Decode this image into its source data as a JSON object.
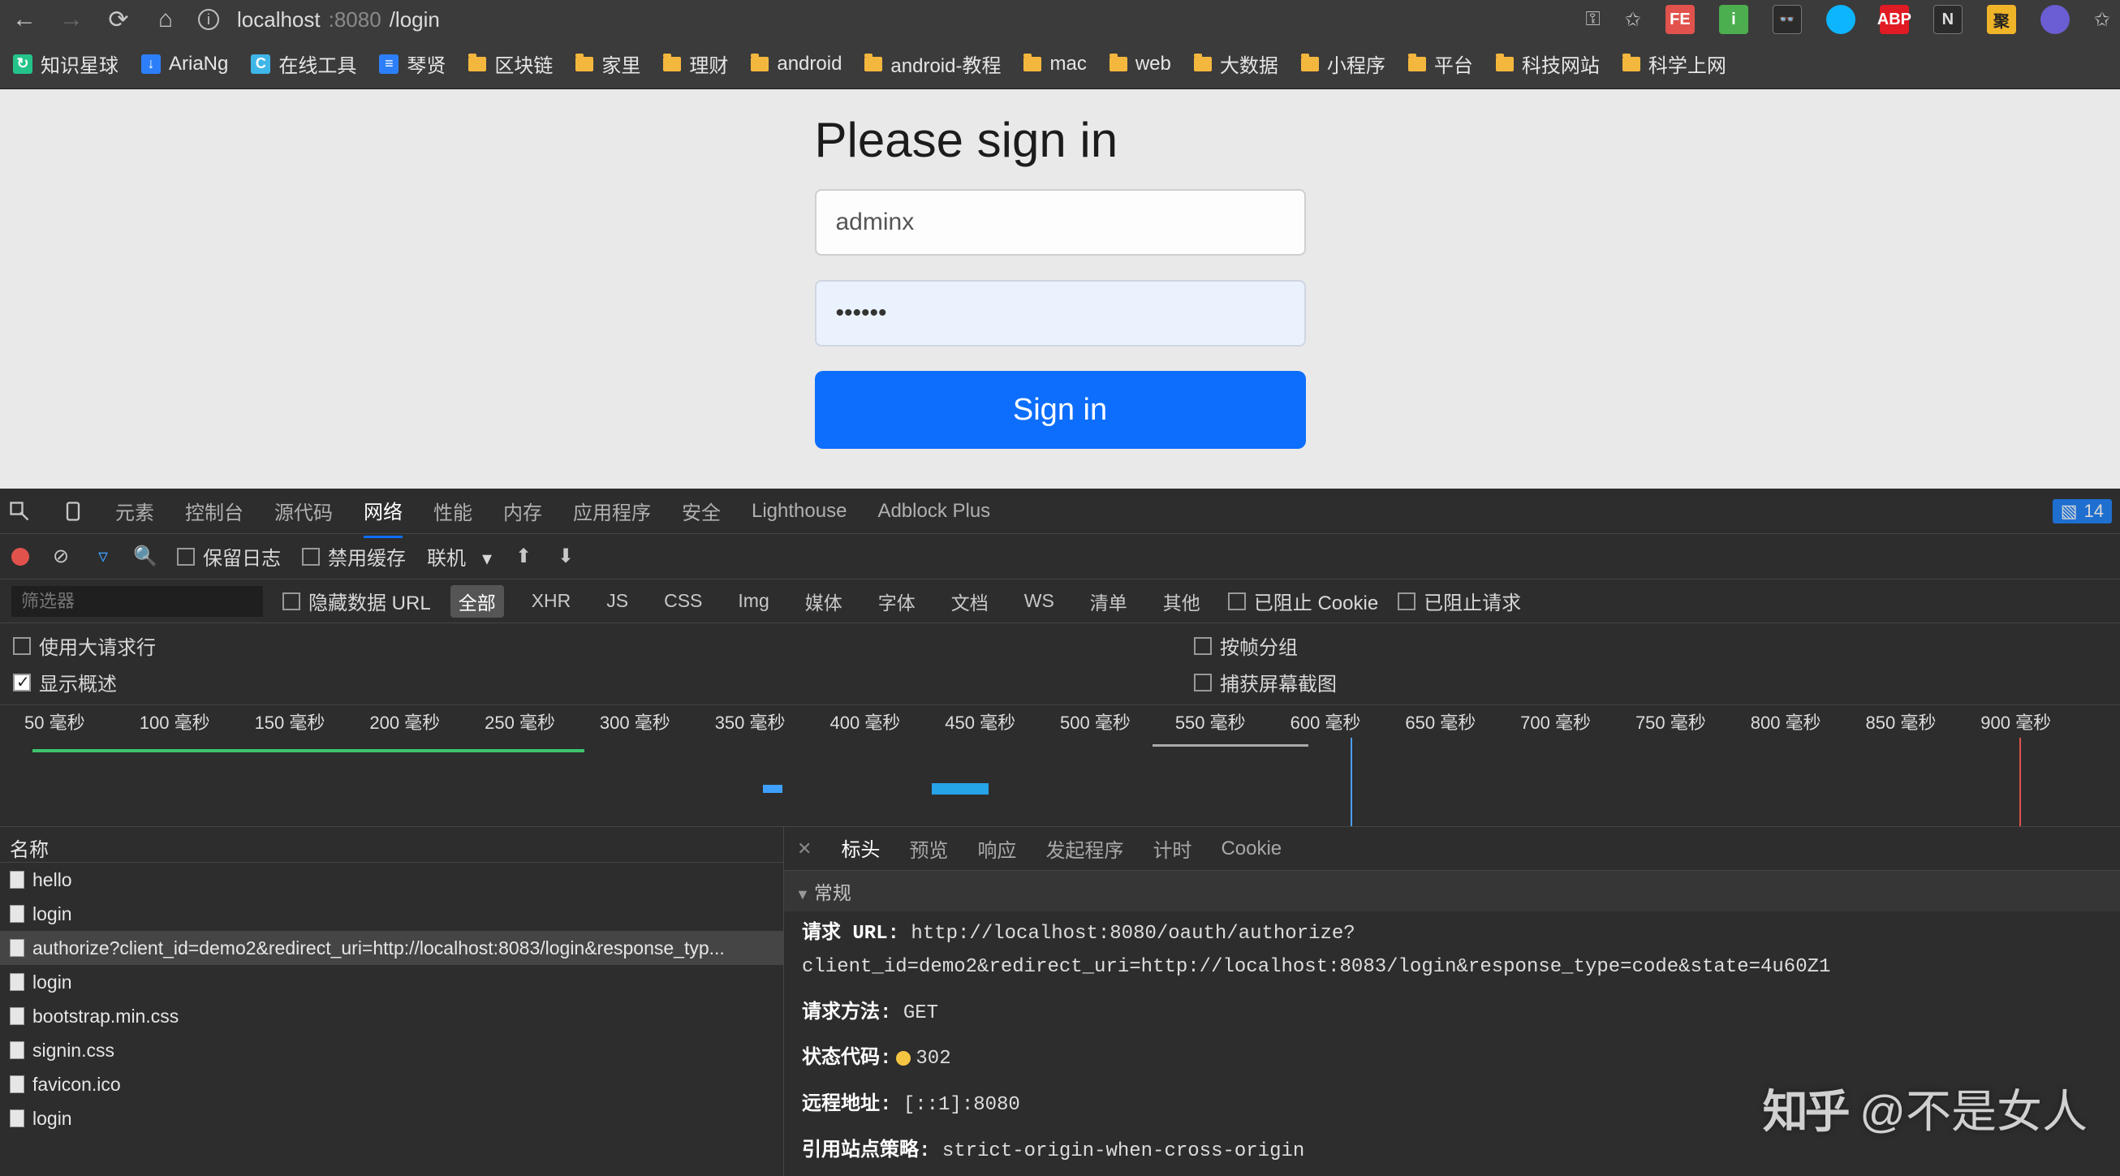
{
  "browser": {
    "url_host": "localhost",
    "url_port": ":8080",
    "url_path": "/login"
  },
  "bookmarks": [
    {
      "icon": "green",
      "label": "知识星球"
    },
    {
      "icon": "blue",
      "label": "AriaNg"
    },
    {
      "icon": "cyan",
      "label": "在线工具"
    },
    {
      "icon": "doc",
      "label": "琴贤"
    },
    {
      "icon": "folder",
      "label": "区块链"
    },
    {
      "icon": "folder",
      "label": "家里"
    },
    {
      "icon": "folder",
      "label": "理财"
    },
    {
      "icon": "folder",
      "label": "android"
    },
    {
      "icon": "folder",
      "label": "android-教程"
    },
    {
      "icon": "folder",
      "label": "mac"
    },
    {
      "icon": "folder",
      "label": "web"
    },
    {
      "icon": "folder",
      "label": "大数据"
    },
    {
      "icon": "folder",
      "label": "小程序"
    },
    {
      "icon": "folder",
      "label": "平台"
    },
    {
      "icon": "folder",
      "label": "科技网站"
    },
    {
      "icon": "folder",
      "label": "科学上网"
    }
  ],
  "page": {
    "title": "Please sign in",
    "username": "adminx",
    "password": "••••••",
    "signin_label": "Sign in"
  },
  "devtools": {
    "tabs": [
      "元素",
      "控制台",
      "源代码",
      "网络",
      "性能",
      "内存",
      "应用程序",
      "安全",
      "Lighthouse",
      "Adblock Plus"
    ],
    "active_tab": "网络",
    "badge_count": "14",
    "preserve_log": "保留日志",
    "disable_cache": "禁用缓存",
    "online": "联机",
    "filter_placeholder": "筛选器",
    "hide_data_url": "隐藏数据 URL",
    "filter_tags": [
      "全部",
      "XHR",
      "JS",
      "CSS",
      "Img",
      "媒体",
      "字体",
      "文档",
      "WS",
      "清单",
      "其他"
    ],
    "blocked_cookie": "已阻止 Cookie",
    "blocked_req": "已阻止请求",
    "use_large": "使用大请求行",
    "show_overview": "显示概述",
    "group_frame": "按帧分组",
    "capture_screenshot": "捕获屏幕截图",
    "timeline_ticks": [
      "50 毫秒",
      "100 毫秒",
      "150 毫秒",
      "200 毫秒",
      "250 毫秒",
      "300 毫秒",
      "350 毫秒",
      "400 毫秒",
      "450 毫秒",
      "500 毫秒",
      "550 毫秒",
      "600 毫秒",
      "650 毫秒",
      "700 毫秒",
      "750 毫秒",
      "800 毫秒",
      "850 毫秒",
      "900 毫秒"
    ],
    "name_col": "名称",
    "requests": [
      "hello",
      "login",
      "authorize?client_id=demo2&redirect_uri=http://localhost:8083/login&response_typ...",
      "login",
      "bootstrap.min.css",
      "signin.css",
      "favicon.ico",
      "login"
    ],
    "selected_req_index": 2,
    "detail_tabs": [
      "标头",
      "预览",
      "响应",
      "发起程序",
      "计时",
      "Cookie"
    ],
    "active_detail_tab": "标头",
    "general_label": "常规",
    "kv": {
      "url_k": "请求 URL:",
      "url_v": "http://localhost:8080/oauth/authorize?client_id=demo2&redirect_uri=http://localhost:8083/login&response_type=code&state=4u60Z1",
      "method_k": "请求方法:",
      "method_v": "GET",
      "status_k": "状态代码:",
      "status_v": "302",
      "remote_k": "远程地址:",
      "remote_v": "[::1]:8080",
      "referrer_k": "引用站点策略:",
      "referrer_v": "strict-origin-when-cross-origin"
    }
  },
  "watermark": {
    "logo": "知乎",
    "text": "@不是女人"
  }
}
